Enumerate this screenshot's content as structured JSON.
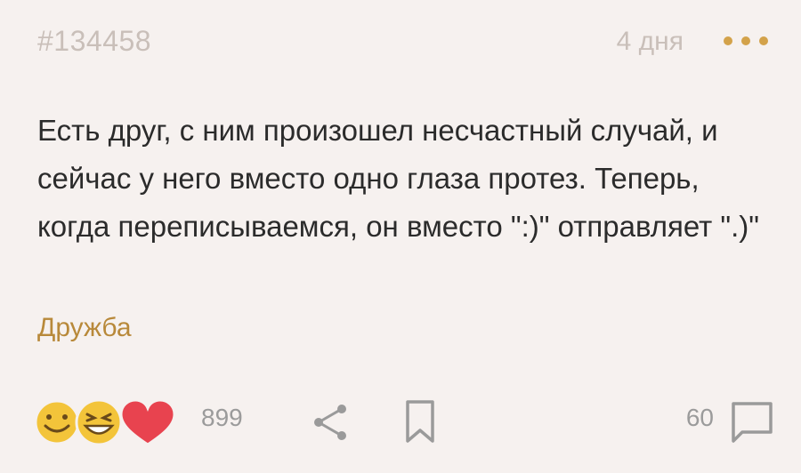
{
  "post": {
    "id": "#134458",
    "time": "4 дня",
    "text": "Есть друг, с ним произошел несчастный случай, и сейчас у него вместо одно глаза протез. Теперь, когда переписываемся, он вместо \":)\" отправляет \".)\"",
    "tag": "Дружба"
  },
  "actions": {
    "reaction_count": "899",
    "comment_count": "60",
    "icons": {
      "more": "more-dots-icon",
      "reaction_smile": "smile-emoji-icon",
      "reaction_laugh": "laugh-emoji-icon",
      "reaction_heart": "heart-icon",
      "share": "share-icon",
      "bookmark": "bookmark-icon",
      "comment": "comment-icon"
    }
  },
  "colors": {
    "background": "#f6f1ef",
    "muted": "#c9bfb9",
    "accent": "#b8893a",
    "heart": "#e8434f",
    "emoji": "#f3c43a",
    "icon": "#9a9a9a"
  }
}
